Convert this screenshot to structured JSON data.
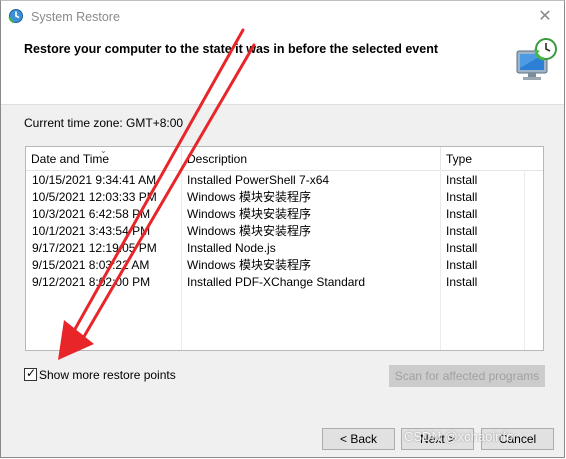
{
  "window": {
    "title": "System Restore",
    "close_glyph": "✕",
    "icon": "system-restore-icon"
  },
  "header": {
    "text": "Restore your computer to the state it was in before the selected event",
    "art": "restore-computer-icon"
  },
  "timezone_label": "Current time zone: GMT+8:00",
  "table": {
    "columns": [
      "Date and Time",
      "Description",
      "Type"
    ],
    "sorted_column": "Date and Time",
    "rows": [
      {
        "date": "10/15/2021 9:34:41 AM",
        "description": "Installed PowerShell 7-x64",
        "type": "Install"
      },
      {
        "date": "10/5/2021 12:03:33 PM",
        "description": "Windows 模块安装程序",
        "type": "Install"
      },
      {
        "date": "10/3/2021 6:42:58 PM",
        "description": "Windows 模块安装程序",
        "type": "Install"
      },
      {
        "date": "10/1/2021 3:43:54 PM",
        "description": "Windows 模块安装程序",
        "type": "Install"
      },
      {
        "date": "9/17/2021 12:19:05 PM",
        "description": "Installed Node.js",
        "type": "Install"
      },
      {
        "date": "9/15/2021 8:03:22 AM",
        "description": "Windows 模块安装程序",
        "type": "Install"
      },
      {
        "date": "9/12/2021 8:02:00 PM",
        "description": "Installed PDF-XChange Standard",
        "type": "Install"
      }
    ]
  },
  "show_more": {
    "label": "Show more restore points",
    "checked": true,
    "check_glyph": "✓"
  },
  "buttons": {
    "scan": "Scan for affected programs",
    "back": "< Back",
    "next": "Next >",
    "cancel": "Cancel"
  },
  "annotation": {
    "color": "#e8262a"
  },
  "watermark": "CSDN @xchaoinfo"
}
